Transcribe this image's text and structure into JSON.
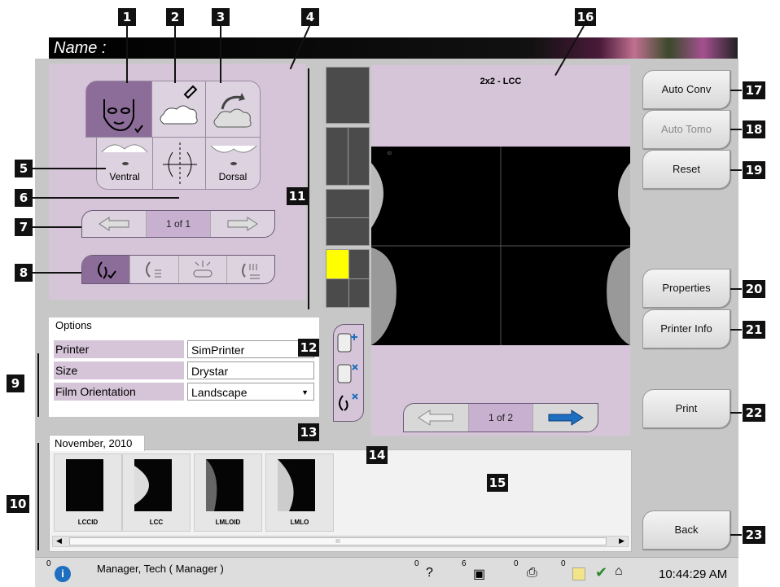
{
  "header": {
    "name_label": "Name :"
  },
  "tools": {
    "ventral": "Ventral",
    "dorsal": "Dorsal"
  },
  "paging_left": {
    "text": "1 of 1"
  },
  "viewer": {
    "title": "2x2 - LCC",
    "page": "1 of 2"
  },
  "options": {
    "legend": "Options",
    "rows": [
      {
        "label": "Printer",
        "value": "SimPrinter"
      },
      {
        "label": "Size",
        "value": "Drystar"
      },
      {
        "label": "Film Orientation",
        "value": "Landscape"
      }
    ]
  },
  "thumbnails": {
    "tab": "November, 2010",
    "items": [
      {
        "label": "LCCID"
      },
      {
        "label": "LCC"
      },
      {
        "label": "LMLOID"
      },
      {
        "label": "LMLO"
      }
    ],
    "scroll_mark": "III"
  },
  "buttons": {
    "auto_conv": "Auto Conv",
    "auto_tomo": "Auto Tomo",
    "reset": "Reset",
    "properties": "Properties",
    "printer_info": "Printer Info",
    "print": "Print",
    "back": "Back"
  },
  "status": {
    "c0": "0",
    "user": "Manager, Tech ( Manager )",
    "c1": "0",
    "c2": "6",
    "c3": "0",
    "c4": "0",
    "time": "10:44:29 AM"
  },
  "callouts": [
    "1",
    "2",
    "3",
    "4",
    "5",
    "6",
    "7",
    "8",
    "9",
    "10",
    "11",
    "12",
    "13",
    "14",
    "15",
    "16",
    "17",
    "18",
    "19",
    "20",
    "21",
    "22",
    "23"
  ],
  "colors": {
    "panel": "#d6c4d8",
    "selected": "#8c6c98",
    "highlight": "#ffff00",
    "arrow_blue": "#1f6fc0"
  }
}
